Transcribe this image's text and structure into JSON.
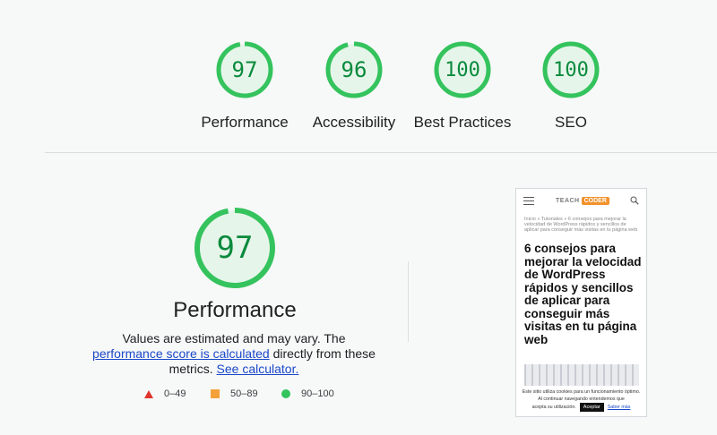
{
  "scores": [
    {
      "label": "Performance",
      "value": "97",
      "fraction": 0.97
    },
    {
      "label": "Accessibility",
      "value": "96",
      "fraction": 0.96
    },
    {
      "label": "Best Practices",
      "value": "100",
      "fraction": 1.0
    },
    {
      "label": "SEO",
      "value": "100",
      "fraction": 1.0
    }
  ],
  "detail": {
    "score": "97",
    "fraction": 0.97,
    "title": "Performance",
    "desc_prefix": "Values are estimated and may vary. The ",
    "link1": "performance score is calculated",
    "desc_mid": " directly from these metrics. ",
    "link2": "See calculator."
  },
  "legend": [
    {
      "range": "0–49",
      "shape": "triangle",
      "color": "#e0342a"
    },
    {
      "range": "50–89",
      "shape": "square",
      "color": "#f5a13a"
    },
    {
      "range": "90–100",
      "shape": "circle",
      "color": "#34c35d"
    }
  ],
  "colors": {
    "pass": "#0a8a3c",
    "pass_ring": "#34c35d",
    "pass_fill": "#e6f5ea"
  },
  "thumbnail": {
    "logo_left": "TEACH",
    "logo_right": "CODER",
    "breadcrumb": "Inicio » Tutoriales » 6 consejos para mejorar la velocidad de WordPress rápidos y sencillos de aplicar para conseguir más visitas en tu página web",
    "title": "6 consejos para mejorar la velocidad de WordPress rápidos y sencillos de aplicar para conseguir más visitas en tu página web",
    "cookie_text": "Este sitio utiliza cookies para un funcionamiento óptimo. Al continuar navegando entendemos que",
    "cookie_accept_prefix": "acepta su utilización.",
    "cookie_accept": "Aceptar",
    "cookie_more": "Saber más"
  }
}
